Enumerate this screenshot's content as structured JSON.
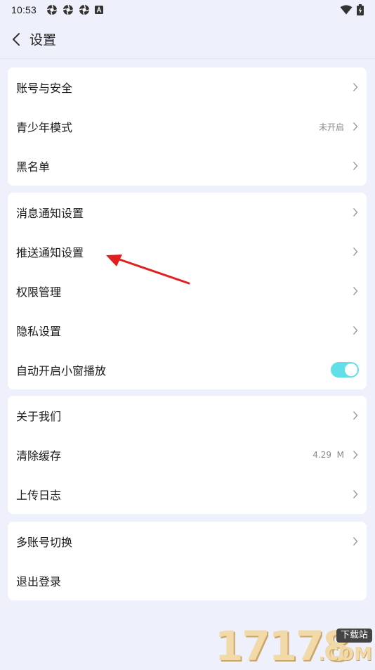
{
  "status_bar": {
    "time": "10:53"
  },
  "header": {
    "title": "设置",
    "back_icon": "chevron-left-icon"
  },
  "groups": [
    {
      "items": [
        {
          "label": "账号与安全",
          "value": ""
        },
        {
          "label": "青少年模式",
          "value": "未开启"
        },
        {
          "label": "黑名单",
          "value": ""
        }
      ]
    },
    {
      "items": [
        {
          "label": "消息通知设置",
          "value": ""
        },
        {
          "label": "推送通知设置",
          "value": ""
        },
        {
          "label": "权限管理",
          "value": ""
        },
        {
          "label": "隐私设置",
          "value": ""
        },
        {
          "label": "自动开启小窗播放",
          "toggle": true
        }
      ]
    },
    {
      "items": [
        {
          "label": "关于我们",
          "value": ""
        },
        {
          "label": "清除缓存",
          "value": "4.29  M"
        },
        {
          "label": "上传日志",
          "value": ""
        }
      ]
    },
    {
      "items": [
        {
          "label": "多账号切换",
          "value": ""
        },
        {
          "label": "退出登录",
          "value": ""
        }
      ]
    }
  ],
  "watermark": {
    "digits": "17178",
    "badge": "下载站",
    "domain": ".COM"
  },
  "colors": {
    "toggle_on": "#5fe0e6",
    "annotation_arrow": "#e02020",
    "background": "#eef1fb"
  }
}
